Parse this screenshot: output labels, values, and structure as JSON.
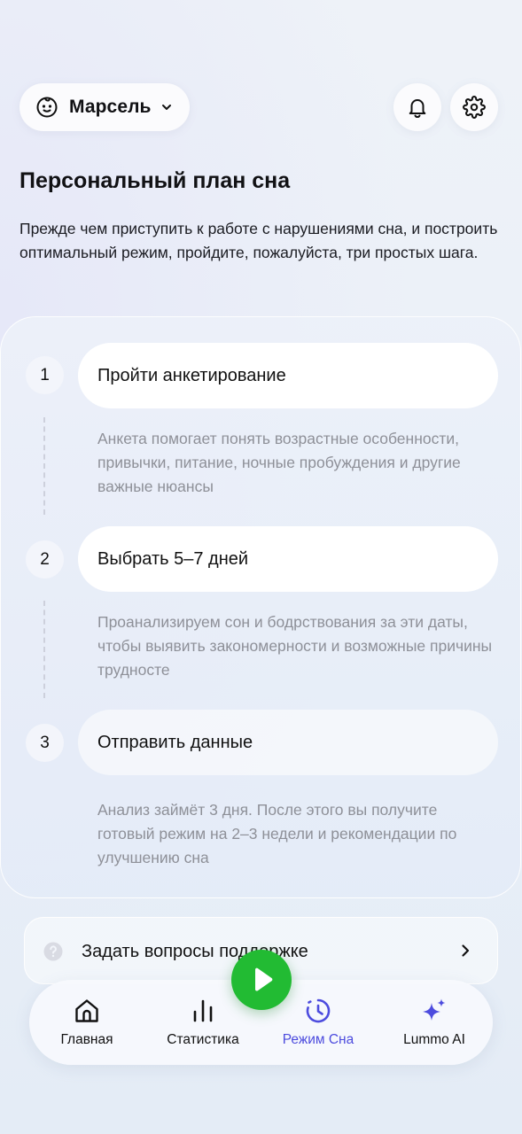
{
  "header": {
    "child_name": "Марсель",
    "icons": {
      "child": "baby-face-icon",
      "chevron": "chevron-down-icon",
      "bell": "bell-icon",
      "settings": "gear-icon"
    }
  },
  "page": {
    "title": "Персональный план сна",
    "intro": "Прежде чем приступить к работе с нарушениями сна, и построить оптимальный режим, пройдите, пожалуйста, три простых шага."
  },
  "steps": [
    {
      "number": "1",
      "title": "Пройти анкетирование",
      "description": "Анкета помогает понять возрастные особенности, привычки, питание, ночные пробуждения и другие важные нюансы"
    },
    {
      "number": "2",
      "title": "Выбрать 5–7 дней",
      "description": "Проанализируем сон и бодрствования за эти даты, чтобы выявить закономерности и возможные причины трудносте"
    },
    {
      "number": "3",
      "title": "Отправить данные",
      "description": "Анализ займёт 3 дня. После этого вы получите готовый режим на 2–3 недели и рекомендации по улучшению сна"
    }
  ],
  "support": {
    "label": "Задать вопросы поддержке",
    "icons": {
      "question": "question-bubble-icon",
      "arrow": "chevron-right-icon"
    }
  },
  "nav": {
    "items": [
      {
        "label": "Главная",
        "icon": "home-icon"
      },
      {
        "label": "Статистика",
        "icon": "bar-chart-icon"
      },
      {
        "label": "Режим Сна",
        "icon": "clock-history-icon",
        "active": true
      },
      {
        "label": "Lummo AI",
        "icon": "sparkle-icon"
      }
    ]
  },
  "fab": {
    "icon": "play-icon"
  },
  "colors": {
    "accent": "#4d4cde",
    "play": "#22bb33",
    "muted_text": "#8e9098"
  }
}
